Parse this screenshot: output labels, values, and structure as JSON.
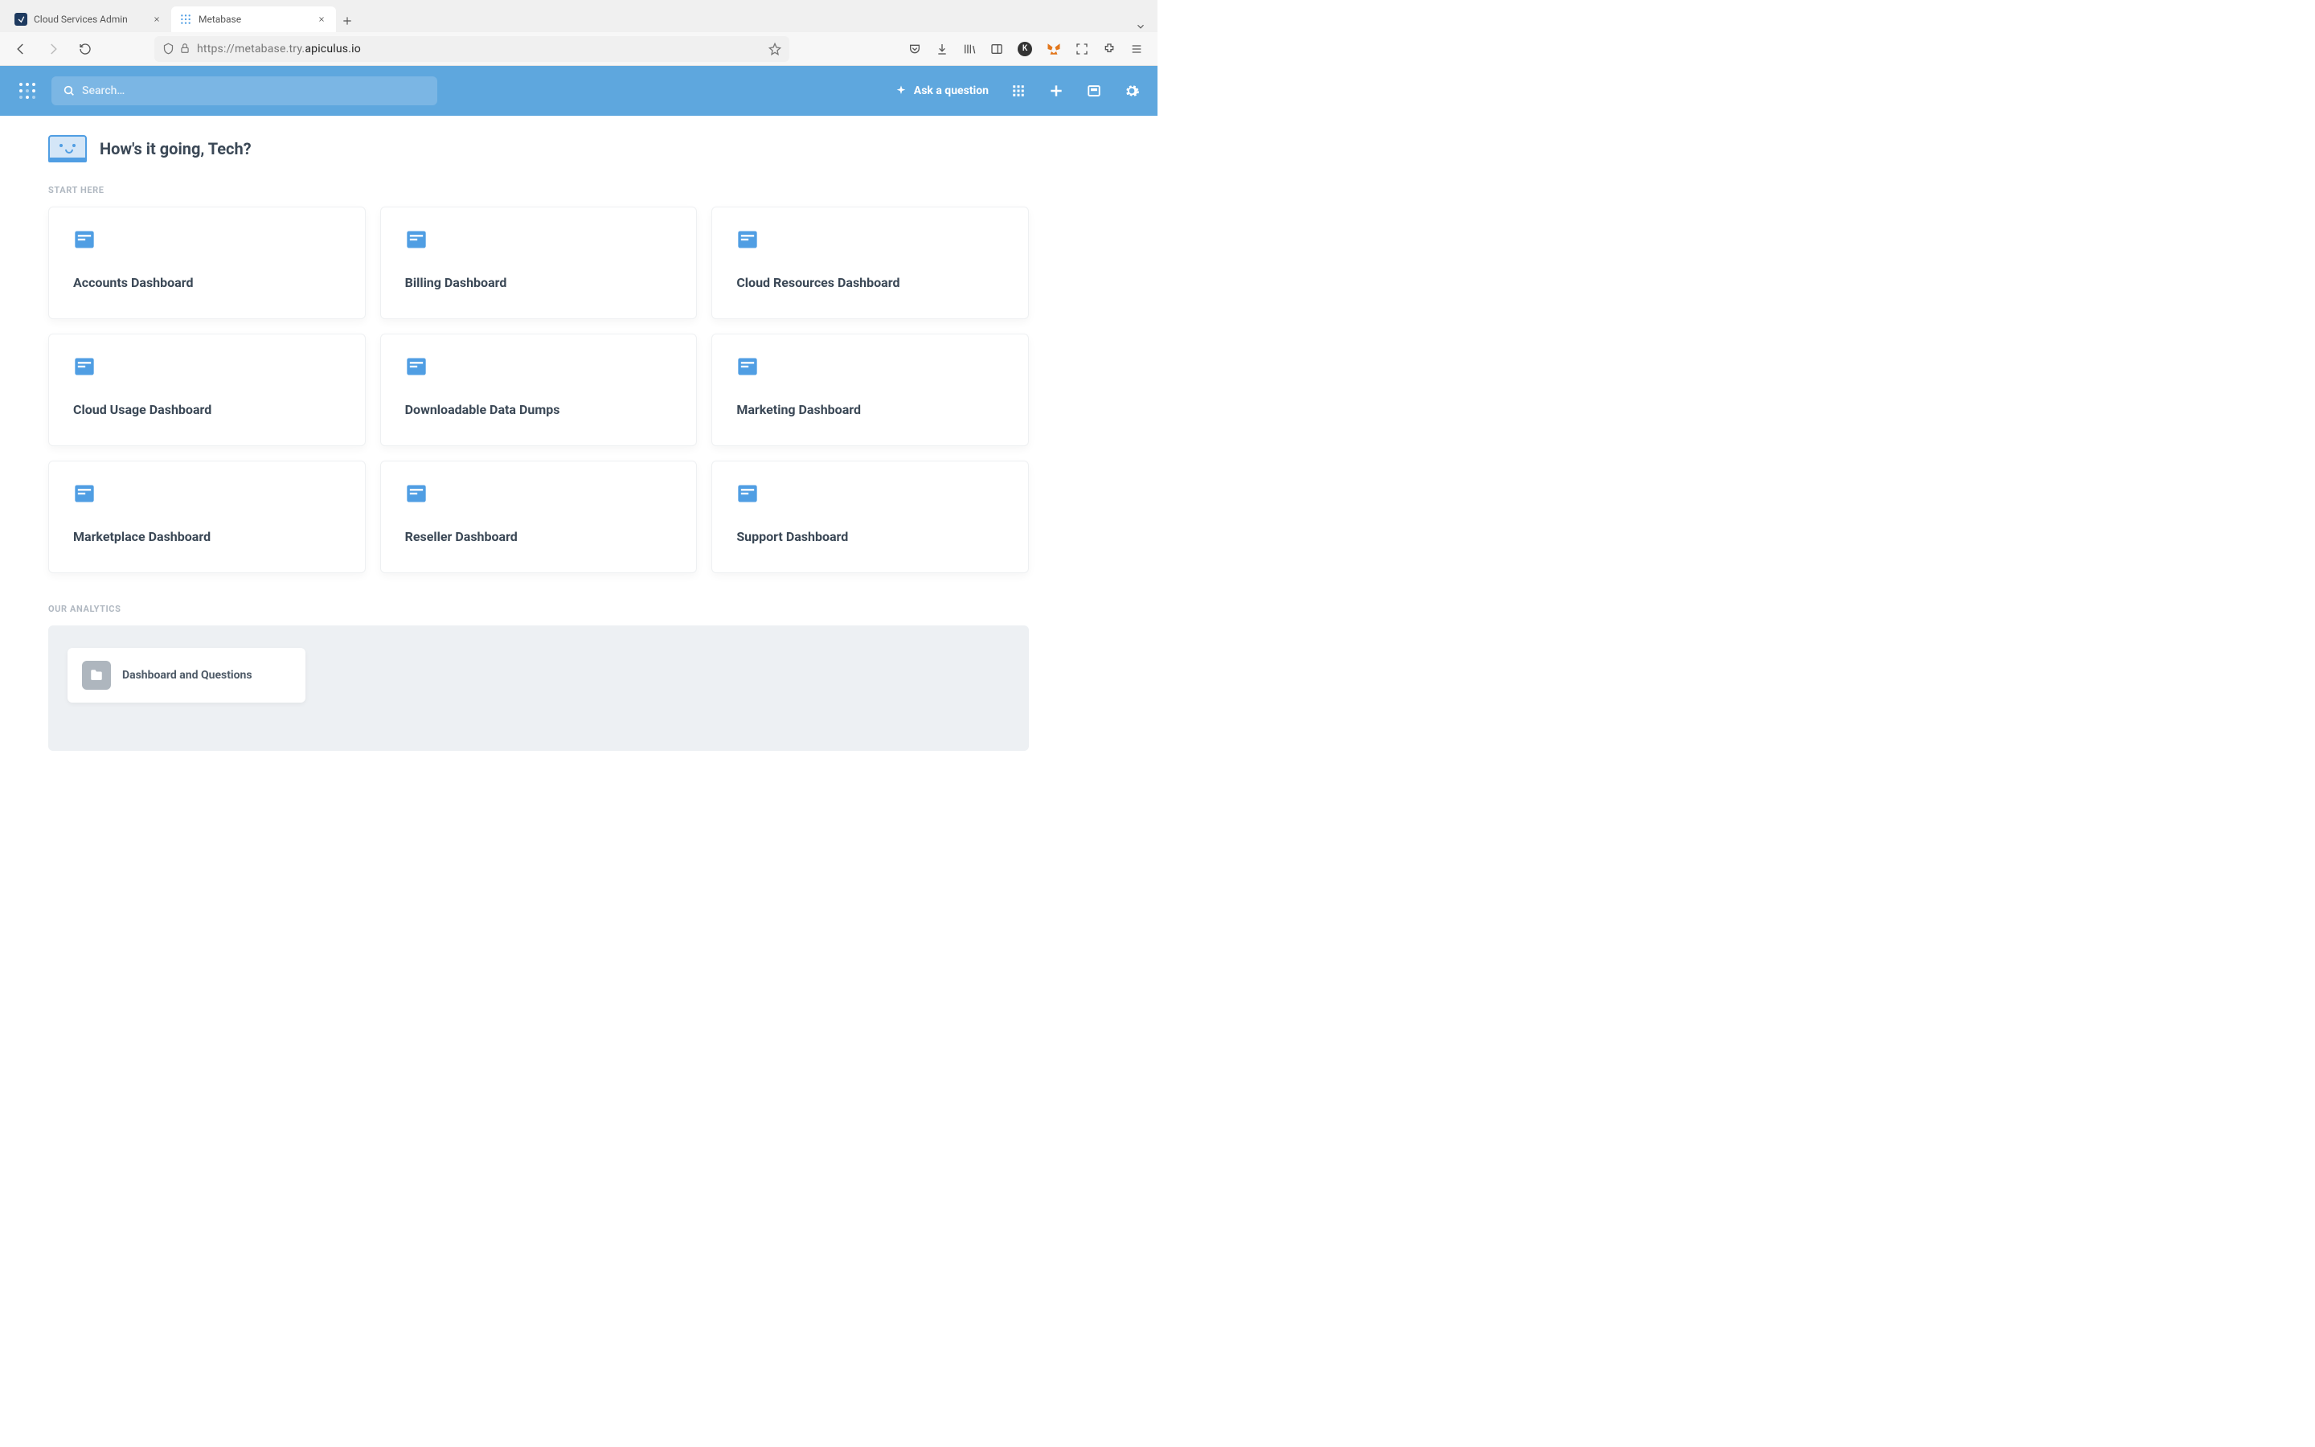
{
  "browser": {
    "tabs": [
      {
        "title": "Cloud Services Admin",
        "active": false
      },
      {
        "title": "Metabase",
        "active": true
      }
    ],
    "url_prefix": "https://metabase.try.",
    "url_domain": "apiculus.io"
  },
  "header": {
    "search_placeholder": "Search…",
    "ask_label": "Ask a question"
  },
  "greeting": "How's it going, Tech?",
  "sections": {
    "start_here": {
      "label": "START HERE",
      "cards": [
        {
          "title": "Accounts Dashboard"
        },
        {
          "title": "Billing Dashboard"
        },
        {
          "title": "Cloud Resources Dashboard"
        },
        {
          "title": "Cloud Usage Dashboard"
        },
        {
          "title": "Downloadable Data Dumps"
        },
        {
          "title": "Marketing Dashboard"
        },
        {
          "title": "Marketplace Dashboard"
        },
        {
          "title": "Reseller Dashboard"
        },
        {
          "title": "Support Dashboard"
        }
      ]
    },
    "our_analytics": {
      "label": "OUR ANALYTICS",
      "collections": [
        {
          "title": "Dashboard and Questions"
        }
      ]
    }
  }
}
